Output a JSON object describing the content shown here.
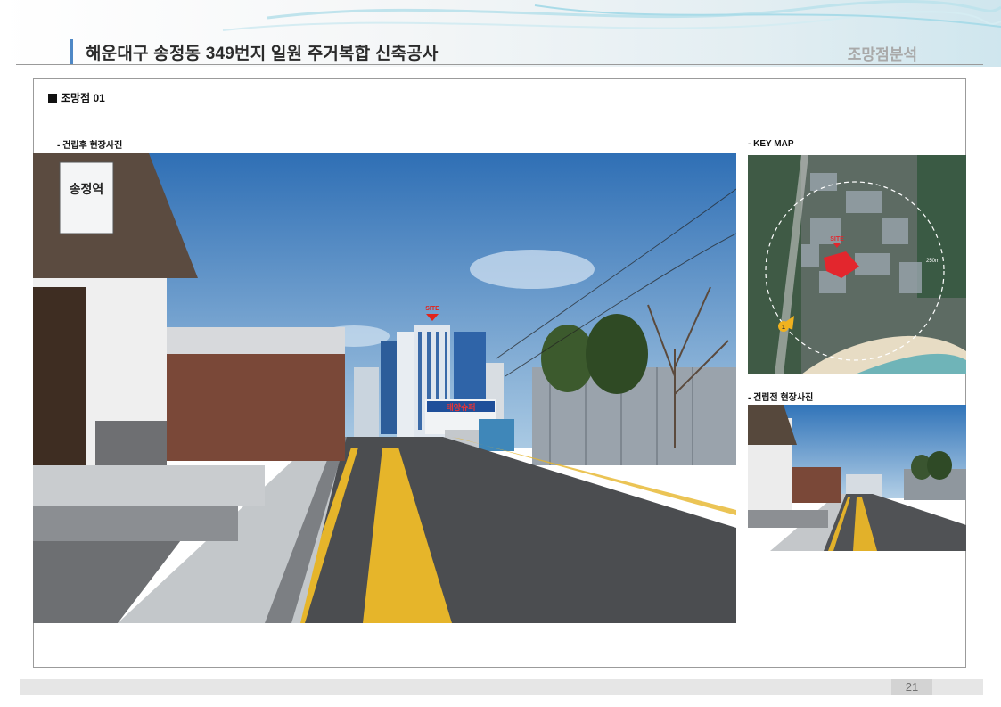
{
  "header": {
    "title": "해운대구 송정동 349번지 일원 주거복합 신축공사",
    "section": "조망점분석"
  },
  "viewpoint": {
    "title": "조망점 01"
  },
  "photos": {
    "after_label": "- 건립후 현장사진",
    "keymap_label": "- KEY MAP",
    "before_label": "- 건립전 현장사진",
    "site_tag": "SITE",
    "station_sign": "송정역",
    "shop_sign": "태양슈퍼",
    "keymap_radius": "250m",
    "keymap_viewpoint": "1"
  },
  "footer": {
    "page_number": "21"
  }
}
